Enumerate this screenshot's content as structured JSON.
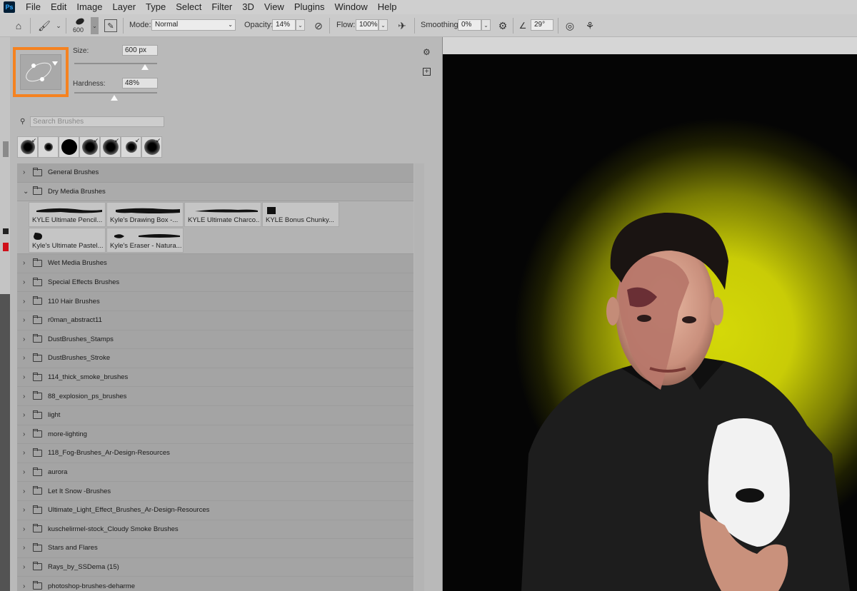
{
  "app": {
    "logo": "Ps"
  },
  "menu": [
    "File",
    "Edit",
    "Image",
    "Layer",
    "Type",
    "Select",
    "Filter",
    "3D",
    "View",
    "Plugins",
    "Window",
    "Help"
  ],
  "options": {
    "brush_size_small": "600",
    "mode_label": "Mode:",
    "mode_value": "Normal",
    "opacity_label": "Opacity:",
    "opacity_value": "14%",
    "flow_label": "Flow:",
    "flow_value": "100%",
    "smoothing_label": "Smoothing:",
    "smoothing_value": "0%",
    "angle_value": "29°"
  },
  "brush_panel": {
    "size_label": "Size:",
    "size_value": "600 px",
    "size_level": 0.85,
    "hardness_label": "Hardness:",
    "hardness_value": "48%",
    "hardness_level": 0.48,
    "search_placeholder": "Search Brushes",
    "groups_before": [
      "General Brushes"
    ],
    "open_group": "Dry Media Brushes",
    "dry_media": [
      "KYLE Ultimate Pencil...",
      "Kyle's Drawing Box -...",
      "KYLE Ultimate Charco...",
      "KYLE Bonus Chunky...",
      "Kyle's Ultimate Pastel...",
      "Kyle's Eraser - Natura..."
    ],
    "groups_after": [
      "Wet Media Brushes",
      "Special Effects Brushes",
      "110 Hair Brushes",
      "r0man_abstract11",
      "DustBrushes_Stamps",
      "DustBrushes_Stroke",
      "114_thick_smoke_brushes",
      "88_explosion_ps_brushes",
      "light",
      "more-lighting",
      "118_Fog-Brushes_Ar-Design-Resources",
      "aurora",
      "Let It Snow -Brushes",
      "Ultimate_Light_Effect_Brushes_Ar-Design-Resources",
      "kuschelirmel-stock_Cloudy Smoke Brushes",
      "Stars and Flares",
      "Rays_by_SSDema (15)",
      "photoshop-brushes-deharme"
    ]
  },
  "colors": {
    "highlight": "#f58220",
    "backdrop_glow": "#d4d808"
  }
}
